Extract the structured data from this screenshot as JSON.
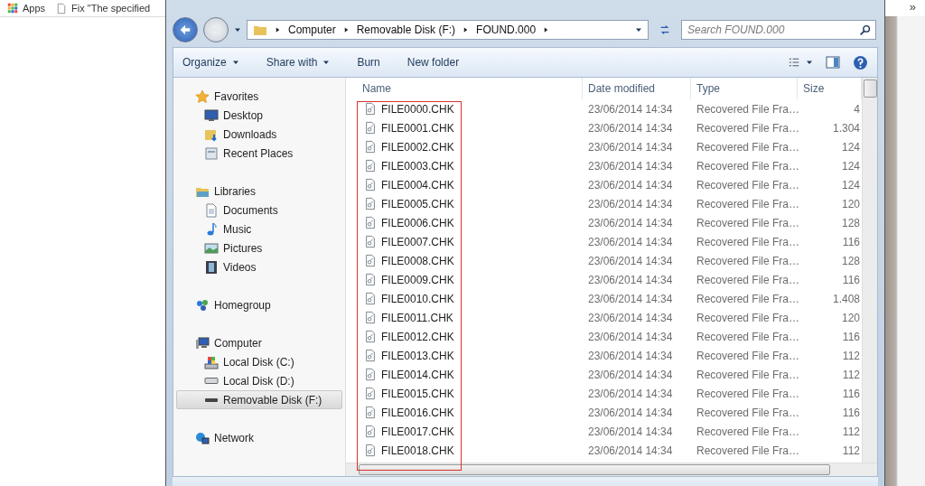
{
  "bookmarks": [
    {
      "label": "Apps",
      "kind": "apps"
    },
    {
      "label": "Fix \"The specified",
      "kind": "page"
    }
  ],
  "bookmarks_overflow": "»",
  "explorer": {
    "address": {
      "segments": [
        "Computer",
        "Removable Disk (F:)",
        "FOUND.000"
      ]
    },
    "search": {
      "placeholder": "Search FOUND.000"
    },
    "toolbar": [
      {
        "label": "Organize",
        "dropdown": true
      },
      {
        "label": "Share with",
        "dropdown": true
      },
      {
        "label": "Burn",
        "dropdown": false
      },
      {
        "label": "New folder",
        "dropdown": false
      }
    ],
    "sidebar": {
      "items": [
        {
          "label": "Favorites",
          "kind": "star",
          "selected": false,
          "children": [
            {
              "label": "Desktop",
              "kind": "desktop",
              "selected": false
            },
            {
              "label": "Downloads",
              "kind": "downloads",
              "selected": false
            },
            {
              "label": "Recent Places",
              "kind": "recent",
              "selected": false
            }
          ]
        },
        {
          "label": "Libraries",
          "kind": "library",
          "selected": false,
          "children": [
            {
              "label": "Documents",
              "kind": "document",
              "selected": false
            },
            {
              "label": "Music",
              "kind": "music",
              "selected": false
            },
            {
              "label": "Pictures",
              "kind": "pictures",
              "selected": false
            },
            {
              "label": "Videos",
              "kind": "videos",
              "selected": false
            }
          ]
        },
        {
          "label": "Homegroup",
          "kind": "homegroup",
          "selected": false
        },
        {
          "label": "Computer",
          "kind": "computer",
          "selected": false,
          "children": [
            {
              "label": "Local Disk (C:)",
              "kind": "system-disk",
              "selected": false
            },
            {
              "label": "Local Disk (D:)",
              "kind": "disk",
              "selected": false
            },
            {
              "label": "Removable Disk (F:)",
              "kind": "removable",
              "selected": true
            }
          ]
        },
        {
          "label": "Network",
          "kind": "network",
          "selected": false
        }
      ]
    },
    "table": {
      "columns": [
        "Name",
        "Date modified",
        "Type",
        "Size"
      ],
      "rows": [
        {
          "name": "FILE0000.CHK",
          "date": "23/06/2014 14:34",
          "type": "Recovered File Fra…",
          "size": "4"
        },
        {
          "name": "FILE0001.CHK",
          "date": "23/06/2014 14:34",
          "type": "Recovered File Fra…",
          "size": "1.304"
        },
        {
          "name": "FILE0002.CHK",
          "date": "23/06/2014 14:34",
          "type": "Recovered File Fra…",
          "size": "124"
        },
        {
          "name": "FILE0003.CHK",
          "date": "23/06/2014 14:34",
          "type": "Recovered File Fra…",
          "size": "124"
        },
        {
          "name": "FILE0004.CHK",
          "date": "23/06/2014 14:34",
          "type": "Recovered File Fra…",
          "size": "124"
        },
        {
          "name": "FILE0005.CHK",
          "date": "23/06/2014 14:34",
          "type": "Recovered File Fra…",
          "size": "120"
        },
        {
          "name": "FILE0006.CHK",
          "date": "23/06/2014 14:34",
          "type": "Recovered File Fra…",
          "size": "128"
        },
        {
          "name": "FILE0007.CHK",
          "date": "23/06/2014 14:34",
          "type": "Recovered File Fra…",
          "size": "116"
        },
        {
          "name": "FILE0008.CHK",
          "date": "23/06/2014 14:34",
          "type": "Recovered File Fra…",
          "size": "128"
        },
        {
          "name": "FILE0009.CHK",
          "date": "23/06/2014 14:34",
          "type": "Recovered File Fra…",
          "size": "116"
        },
        {
          "name": "FILE0010.CHK",
          "date": "23/06/2014 14:34",
          "type": "Recovered File Fra…",
          "size": "1.408"
        },
        {
          "name": "FILE0011.CHK",
          "date": "23/06/2014 14:34",
          "type": "Recovered File Fra…",
          "size": "120"
        },
        {
          "name": "FILE0012.CHK",
          "date": "23/06/2014 14:34",
          "type": "Recovered File Fra…",
          "size": "116"
        },
        {
          "name": "FILE0013.CHK",
          "date": "23/06/2014 14:34",
          "type": "Recovered File Fra…",
          "size": "112"
        },
        {
          "name": "FILE0014.CHK",
          "date": "23/06/2014 14:34",
          "type": "Recovered File Fra…",
          "size": "112"
        },
        {
          "name": "FILE0015.CHK",
          "date": "23/06/2014 14:34",
          "type": "Recovered File Fra…",
          "size": "116"
        },
        {
          "name": "FILE0016.CHK",
          "date": "23/06/2014 14:34",
          "type": "Recovered File Fra…",
          "size": "116"
        },
        {
          "name": "FILE0017.CHK",
          "date": "23/06/2014 14:34",
          "type": "Recovered File Fra…",
          "size": "112"
        },
        {
          "name": "FILE0018.CHK",
          "date": "23/06/2014 14:34",
          "type": "Recovered File Fra…",
          "size": "112"
        }
      ]
    }
  }
}
